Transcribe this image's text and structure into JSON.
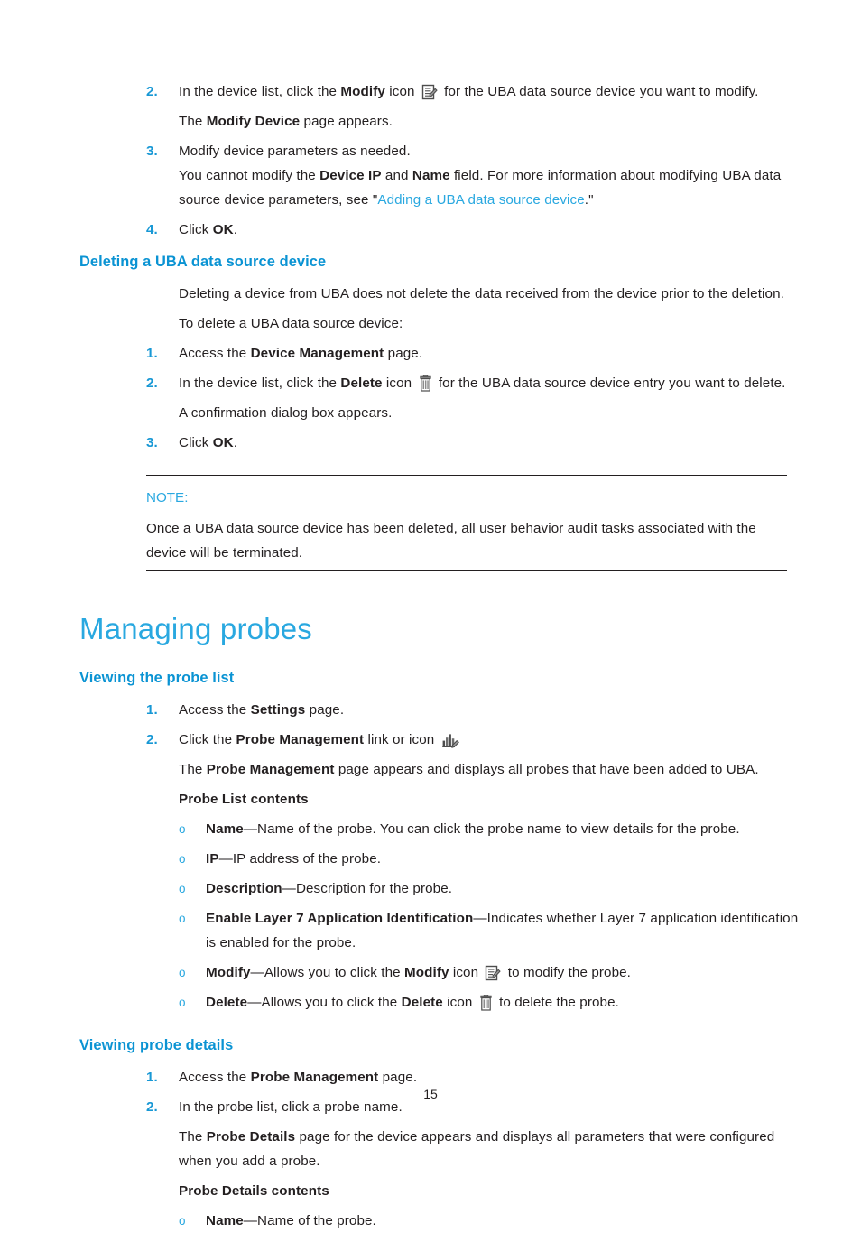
{
  "page": {
    "number": "15"
  },
  "colors": {
    "heading_blue": "#29a8e0",
    "section_blue": "#0a93d3",
    "number_blue": "#1898d5",
    "body_black": "#231f20"
  },
  "modify_steps": {
    "items": [
      {
        "num": "2.",
        "pre": "In the device list, click the ",
        "bold": "Modify",
        "post": " icon ",
        "icon": "modify-icon",
        "tail": " for the UBA data source device you want to modify.",
        "followup_pre": "The ",
        "followup_bold": "Modify Device",
        "followup_post": " page appears."
      },
      {
        "num": "3.",
        "text": "Modify device parameters as needed.",
        "followup_a": "You cannot modify the ",
        "followup_b1": "Device IP",
        "followup_c": " and ",
        "followup_b2": "Name",
        "followup_d": " field. For more information about modifying UBA data source device parameters, see \"",
        "link": "Adding a UBA data source device",
        "followup_e": ".\""
      },
      {
        "num": "4.",
        "pre": "Click ",
        "bold": "OK",
        "post": "."
      }
    ]
  },
  "deleting_section": {
    "heading": "Deleting a UBA data source device",
    "intro": "Deleting a device from UBA does not delete the data received from the device prior to the deletion.",
    "lead_in": "To delete a UBA data source device:",
    "steps": [
      {
        "num": "1.",
        "pre": "Access the ",
        "bold": "Device Management",
        "post": " page."
      },
      {
        "num": "2.",
        "pre": "In the device list, click the ",
        "bold": "Delete",
        "post": " icon ",
        "icon": "delete-icon",
        "tail": " for the UBA data source device entry you want to delete.",
        "followup": "A confirmation dialog box appears."
      },
      {
        "num": "3.",
        "pre": "Click ",
        "bold": "OK",
        "post": "."
      }
    ]
  },
  "note": {
    "label": "NOTE:",
    "body": "Once a UBA data source device has been deleted, all user behavior audit tasks associated with the device will be terminated."
  },
  "managing_probes": {
    "title": "Managing probes",
    "viewing_probe_list": {
      "heading": "Viewing the probe list",
      "steps": [
        {
          "num": "1.",
          "pre": "Access the ",
          "bold": "Settings",
          "post": " page."
        },
        {
          "num": "2.",
          "pre": "Click the ",
          "bold": "Probe Management",
          "post": " link or icon ",
          "icon": "probe-management-icon",
          "followup_pre": "The ",
          "followup_bold": "Probe Management",
          "followup_post": " page appears and displays all probes that have been added to UBA."
        }
      ],
      "contents_title": "Probe List contents",
      "contents": [
        {
          "bullet": "o",
          "term": "Name",
          "desc": "—Name of the probe. You can click the probe name to view details for the probe."
        },
        {
          "bullet": "o",
          "term": "IP",
          "desc": "—IP address of the probe."
        },
        {
          "bullet": "o",
          "term": "Description",
          "desc": "—Description for the probe."
        },
        {
          "bullet": "o",
          "term": "Enable Layer 7 Application Identification",
          "desc": "—Indicates whether Layer 7 application identification is enabled for the probe."
        },
        {
          "bullet": "o",
          "term": "Modify",
          "desc_pre": "—Allows you to click the ",
          "desc_bold": "Modify",
          "desc_mid": " icon ",
          "icon": "modify-icon",
          "desc_post": " to modify the probe."
        },
        {
          "bullet": "o",
          "term": "Delete",
          "desc_pre": "—Allows you to click the ",
          "desc_bold": "Delete",
          "desc_mid": " icon ",
          "icon": "delete-icon",
          "desc_post": " to delete the probe."
        }
      ]
    },
    "viewing_probe_details": {
      "heading": "Viewing probe details",
      "steps": [
        {
          "num": "1.",
          "pre": "Access the ",
          "bold": "Probe Management",
          "post": " page."
        },
        {
          "num": "2.",
          "text": "In the probe list, click a probe name.",
          "followup_pre": "The ",
          "followup_bold": "Probe Details",
          "followup_post": " page for the device appears and displays all parameters that were configured when you add a probe."
        }
      ],
      "contents_title": "Probe Details contents",
      "contents": [
        {
          "bullet": "o",
          "term": "Name",
          "desc": "—Name of the probe."
        }
      ]
    }
  }
}
